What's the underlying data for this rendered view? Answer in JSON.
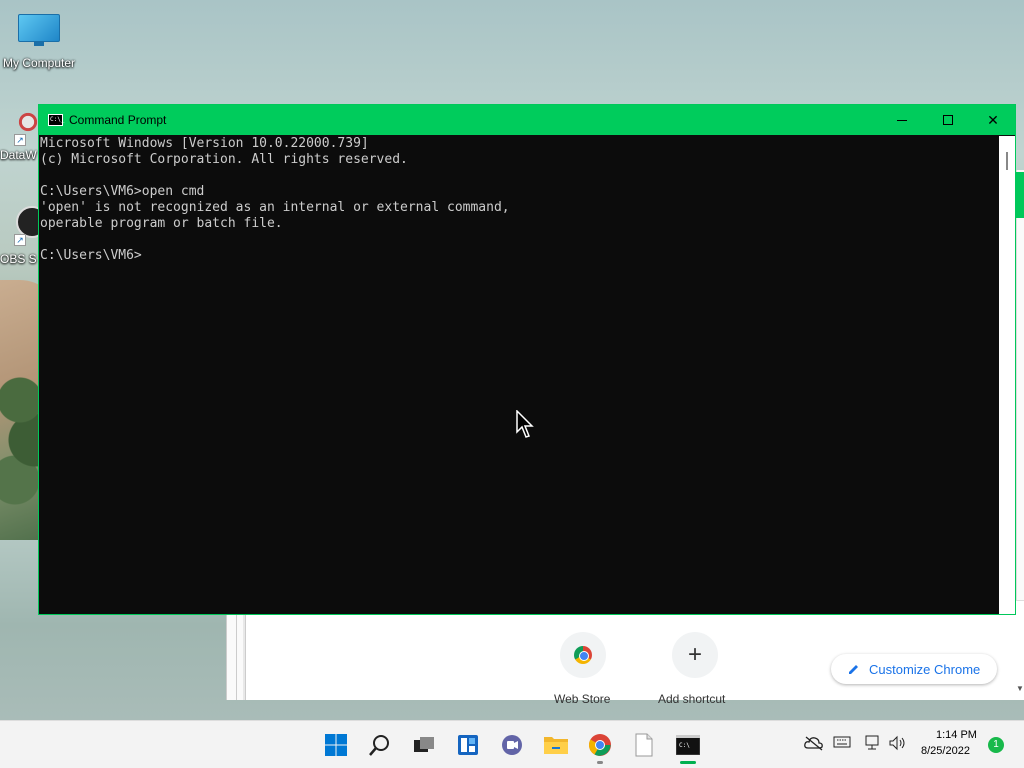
{
  "desktop": {
    "icons": [
      {
        "label": "My Computer",
        "icon": "monitor-icon"
      },
      {
        "label": "DataW",
        "icon": "datawrapper-icon"
      },
      {
        "label": "OBS S",
        "icon": "obs-icon"
      }
    ]
  },
  "chrome_background": {
    "tiles": [
      {
        "label": "Web Store",
        "icon": "chrome-icon"
      },
      {
        "label": "Add shortcut",
        "icon": "plus-icon",
        "glyph": "+"
      }
    ],
    "customize_label": "Customize Chrome"
  },
  "cmd_window": {
    "title": "Command Prompt",
    "icon_text": "C:\\_",
    "controls": {
      "minimize": "minimize-icon",
      "maximize": "maximize-icon",
      "close": "close-icon",
      "close_glyph": "✕"
    },
    "lines": [
      "Microsoft Windows [Version 10.0.22000.739]",
      "(c) Microsoft Corporation. All rights reserved.",
      "",
      "C:\\Users\\VM6>open cmd",
      "'open' is not recognized as an internal or external command,",
      "operable program or batch file.",
      "",
      "C:\\Users\\VM6>"
    ]
  },
  "taskbar": {
    "apps": [
      "start-icon",
      "search-icon",
      "task-view-icon",
      "widgets-icon",
      "chat-icon",
      "file-explorer-icon",
      "chrome-icon",
      "notepad-icon",
      "command-prompt-icon"
    ],
    "tray": [
      "onedrive-icon",
      "keyboard-icon",
      "network-icon",
      "volume-icon"
    ],
    "time": "1:14 PM",
    "date": "8/25/2022",
    "notification_count": "1"
  },
  "colors": {
    "cmd_titlebar": "#00cc5c",
    "cmd_background": "#0c0c0c",
    "cmd_text": "#cccccc",
    "accent_chrome": "#1a73e8"
  }
}
